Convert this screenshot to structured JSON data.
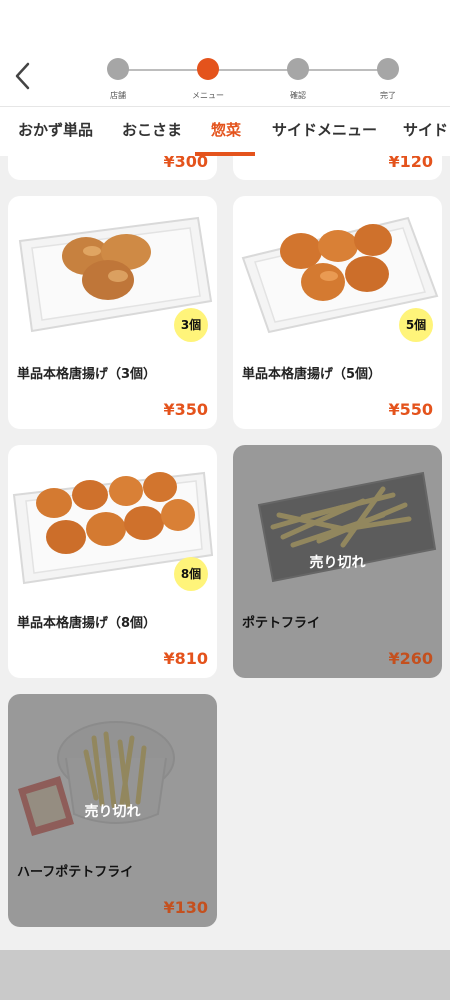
{
  "header": {
    "steps": [
      {
        "label": "店舗",
        "state": "done"
      },
      {
        "label": "メニュー",
        "state": "active"
      },
      {
        "label": "確認",
        "state": "todo"
      },
      {
        "label": "完了",
        "state": "todo"
      }
    ]
  },
  "tabs": {
    "items": [
      "おかず単品",
      "おこさま",
      "惣菜",
      "サイドメニュー",
      "サイド"
    ],
    "active_index": 2
  },
  "products": {
    "partial": [
      {
        "price": "¥300"
      },
      {
        "price": "¥120"
      }
    ],
    "items": [
      {
        "name": "単品本格唐揚げ（3個）",
        "price": "¥350",
        "badge": "3個",
        "sold_out": false
      },
      {
        "name": "単品本格唐揚げ（5個）",
        "price": "¥550",
        "badge": "5個",
        "sold_out": false
      },
      {
        "name": "単品本格唐揚げ（8個）",
        "price": "¥810",
        "badge": "8個",
        "sold_out": false
      },
      {
        "name": "ポテトフライ",
        "price": "¥260",
        "sold_out": true,
        "sold_out_label": "売り切れ"
      },
      {
        "name": "ハーフポテトフライ",
        "price": "¥130",
        "sold_out": true,
        "sold_out_label": "売り切れ"
      }
    ]
  },
  "colors": {
    "accent": "#e4531c",
    "badge": "#fff47a",
    "step_inactive": "#a6a6a6"
  }
}
